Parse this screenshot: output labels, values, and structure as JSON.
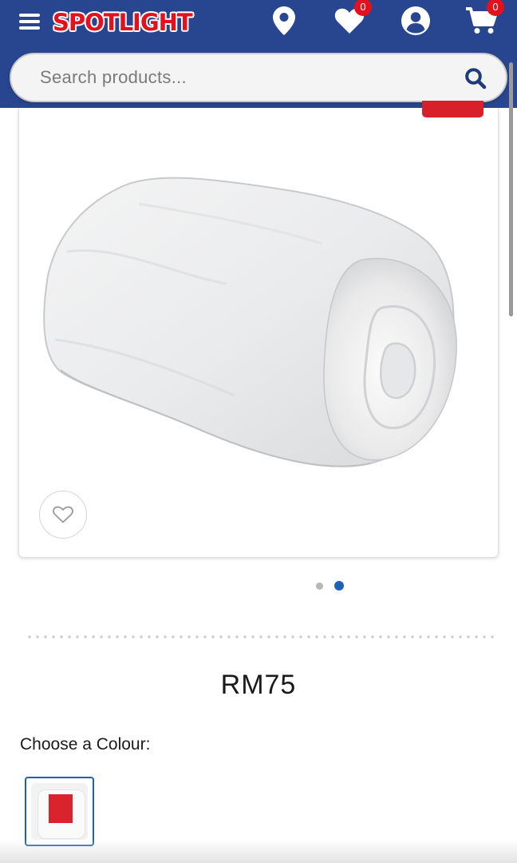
{
  "header": {
    "logo_text": "SPOTLIGHT",
    "wishlist_count": "0",
    "cart_count": "0",
    "background_color": "#28458f",
    "icons": [
      "menu-icon",
      "location-pin-icon",
      "heart-icon",
      "account-icon",
      "cart-icon"
    ]
  },
  "search": {
    "placeholder": "Search products..."
  },
  "product": {
    "image": "rolled-white-quilt",
    "price": "RM75",
    "choose_colour_label": "Choose a Colour:",
    "carousel": {
      "total_slides": 2,
      "active_slide": 2
    },
    "accent_color": "#1c62b8",
    "sale_color": "#d8202b"
  }
}
